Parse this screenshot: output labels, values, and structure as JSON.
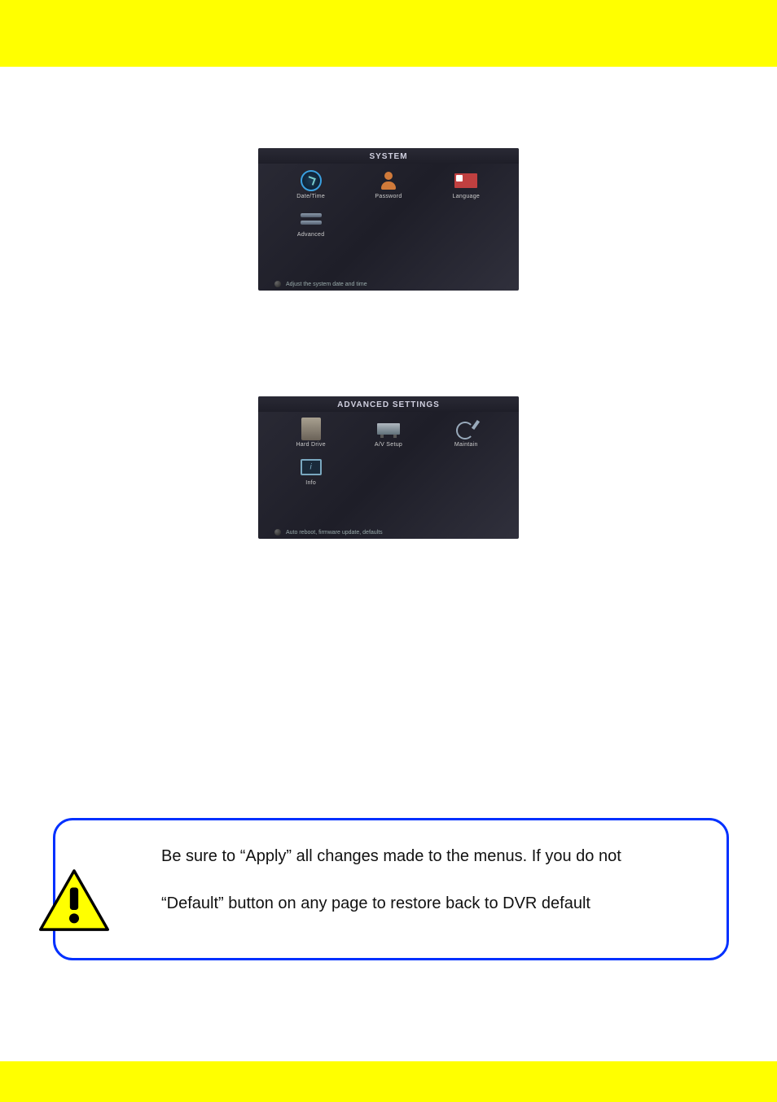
{
  "screenshot1": {
    "title": "SYSTEM",
    "icons": [
      {
        "name": "date-time-icon",
        "label": "Date/Time"
      },
      {
        "name": "password-icon",
        "label": "Password"
      },
      {
        "name": "language-icon",
        "label": "Language"
      },
      {
        "name": "advanced-icon",
        "label": "Advanced"
      }
    ],
    "footer": "Adjust the system date and time"
  },
  "screenshot2": {
    "title": "ADVANCED SETTINGS",
    "icons": [
      {
        "name": "hard-drive-icon",
        "label": "Hard Drive"
      },
      {
        "name": "av-setup-icon",
        "label": "A/V Setup"
      },
      {
        "name": "maintain-icon",
        "label": "Maintain"
      },
      {
        "name": "info-icon",
        "label": "Info"
      }
    ],
    "footer": "Auto reboot, firmware update, defaults"
  },
  "note": {
    "line1": "Be sure to “Apply” all changes made to the menus. If you do not",
    "line2": "“Default” button on any page to restore back to DVR default"
  }
}
